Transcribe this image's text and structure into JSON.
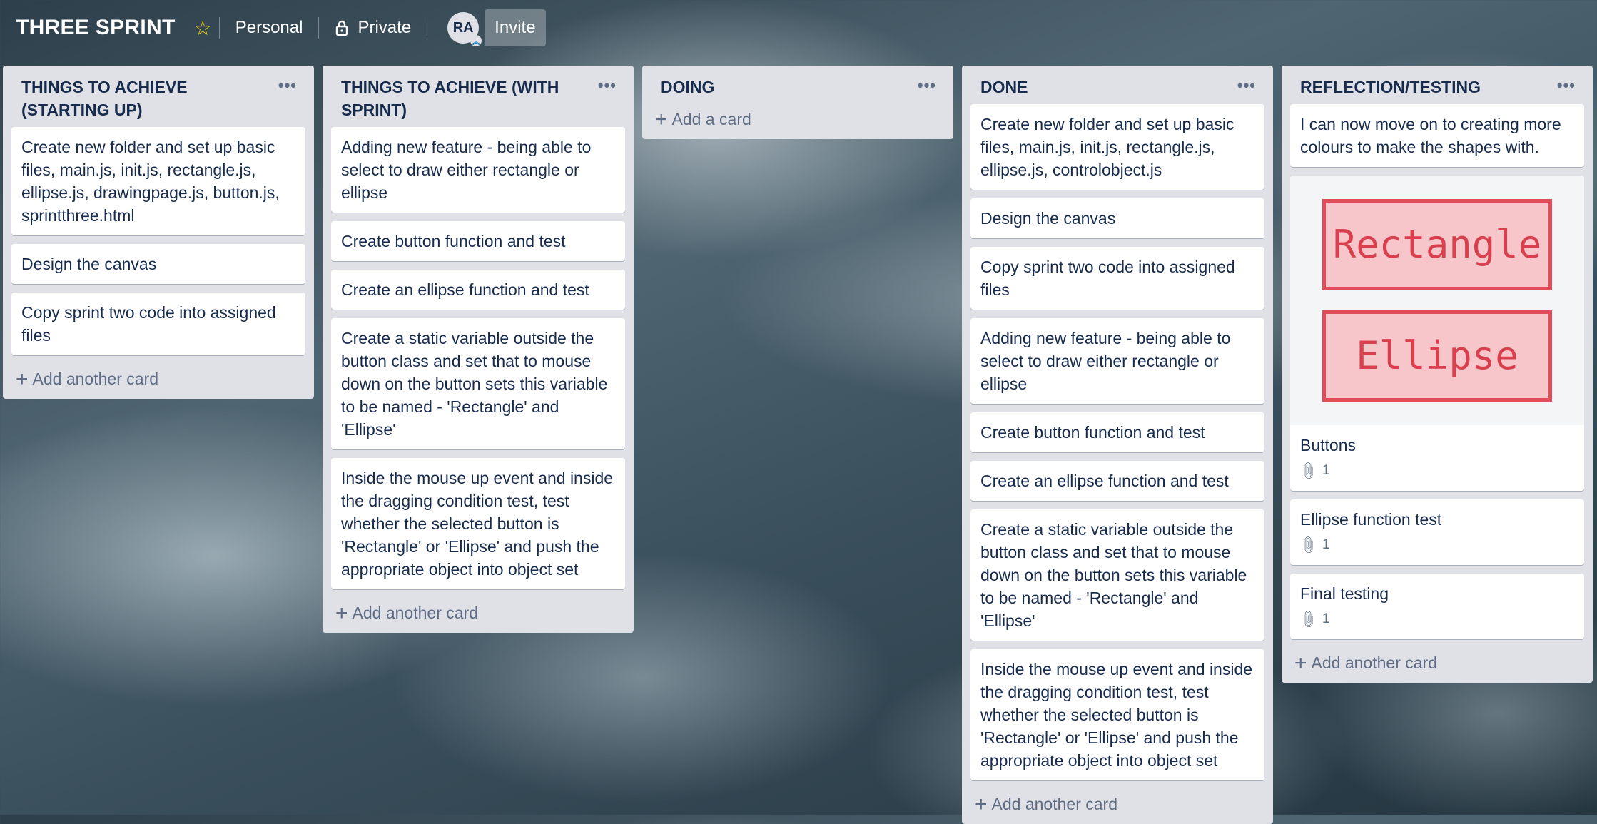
{
  "header": {
    "title": "THREE SPRINT",
    "star_icon": "star-icon",
    "team": "Personal",
    "visibility": "Private",
    "avatar_initials": "RA",
    "invite": "Invite"
  },
  "lists": [
    {
      "title": "THINGS TO ACHIEVE (STARTING UP)",
      "cards": [
        "Create new folder and set up basic files, main.js, init.js, rectangle.js, ellipse.js, drawingpage.js, button.js, sprintthree.html",
        "Design the canvas",
        "Copy sprint two code into assigned files"
      ],
      "add_label": "Add another card"
    },
    {
      "title": "THINGS TO ACHIEVE (WITH SPRINT)",
      "cards": [
        "Adding new feature - being able to select to draw either rectangle or ellipse",
        "Create button function and test",
        "Create an ellipse function and test",
        "Create a static variable outside the button class and set that to mouse down on the button sets this variable to be named - 'Rectangle' and 'Ellipse'",
        "Inside the mouse up event and inside the dragging condition test, test whether the selected button is 'Rectangle' or 'Ellipse' and push the appropriate object into object set"
      ],
      "add_label": "Add another card"
    },
    {
      "title": "DOING",
      "cards": [],
      "add_label": "Add a card"
    },
    {
      "title": "DONE",
      "cards": [
        "Create new folder and set up basic files, main.js, init.js, rectangle.js, ellipse.js, controlobject.js",
        "Design the canvas",
        "Copy sprint two code into assigned files",
        "Adding new feature - being able to select to draw either rectangle or ellipse",
        "Create button function and test",
        "Create an ellipse function and test",
        "Create a static variable outside the button class and set that to mouse down on the button sets this variable to be named - 'Rectangle' and 'Ellipse'",
        "Inside the mouse up event and inside the dragging condition test, test whether the selected button is 'Rectangle' or 'Ellipse' and push the appropriate object into object set"
      ],
      "add_label": "Add another card"
    },
    {
      "title": "REFLECTION/TESTING",
      "first_card": "I can now move on to creating more colours to make the shapes with.",
      "cover_card": {
        "cover_labels": [
          "Rectangle",
          "Ellipse"
        ],
        "title": "Buttons",
        "attachments": "1"
      },
      "badge_cards": [
        {
          "title": "Ellipse function test",
          "attachments": "1"
        },
        {
          "title": "Final testing",
          "attachments": "1"
        }
      ],
      "add_label": "Add another card"
    }
  ]
}
